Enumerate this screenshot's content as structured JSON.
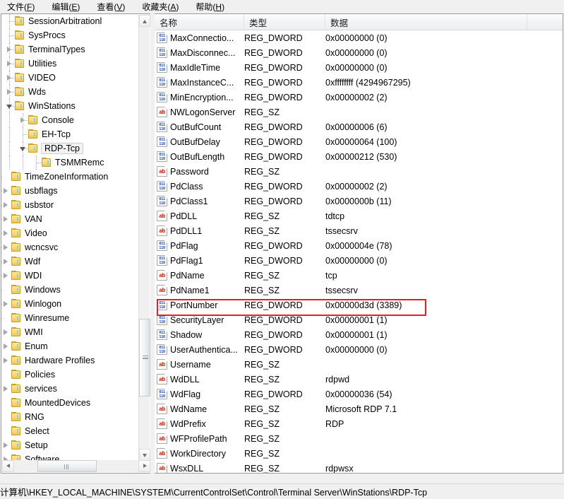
{
  "menu": {
    "items": [
      {
        "label": "文件(F)",
        "mnemonic": "F",
        "base": "文件("
      },
      {
        "label": "编辑(E)",
        "mnemonic": "E",
        "base": "编辑("
      },
      {
        "label": "查看(V)",
        "mnemonic": "V",
        "base": "查看("
      },
      {
        "label": "收藏夹(A)",
        "mnemonic": "A",
        "base": "收藏夹("
      },
      {
        "label": "帮助(H)",
        "mnemonic": "H",
        "base": "帮助("
      }
    ]
  },
  "tree": {
    "nodes": [
      {
        "label": "SessionArbitrationl",
        "indent": 3,
        "arrow": "none",
        "selected": false
      },
      {
        "label": "SysProcs",
        "indent": 3,
        "arrow": "none",
        "selected": false
      },
      {
        "label": "TerminalTypes",
        "indent": 3,
        "arrow": "collapsed",
        "selected": false
      },
      {
        "label": "Utilities",
        "indent": 3,
        "arrow": "collapsed",
        "selected": false
      },
      {
        "label": "VIDEO",
        "indent": 3,
        "arrow": "collapsed",
        "selected": false
      },
      {
        "label": "Wds",
        "indent": 3,
        "arrow": "collapsed",
        "selected": false
      },
      {
        "label": "WinStations",
        "indent": 3,
        "arrow": "expanded",
        "selected": false
      },
      {
        "label": "Console",
        "indent": 4,
        "arrow": "collapsed",
        "selected": false
      },
      {
        "label": "EH-Tcp",
        "indent": 4,
        "arrow": "none",
        "selected": false
      },
      {
        "label": "RDP-Tcp",
        "indent": 4,
        "arrow": "expanded",
        "selected": true
      },
      {
        "label": "TSMMRemc",
        "indent": 5,
        "arrow": "none",
        "selected": false
      },
      {
        "label": "TimeZoneInformation",
        "indent": 2,
        "arrow": "none",
        "selected": false
      },
      {
        "label": "usbflags",
        "indent": 2,
        "arrow": "collapsed",
        "selected": false
      },
      {
        "label": "usbstor",
        "indent": 2,
        "arrow": "collapsed",
        "selected": false
      },
      {
        "label": "VAN",
        "indent": 2,
        "arrow": "collapsed",
        "selected": false
      },
      {
        "label": "Video",
        "indent": 2,
        "arrow": "collapsed",
        "selected": false
      },
      {
        "label": "wcncsvc",
        "indent": 2,
        "arrow": "collapsed",
        "selected": false
      },
      {
        "label": "Wdf",
        "indent": 2,
        "arrow": "collapsed",
        "selected": false
      },
      {
        "label": "WDI",
        "indent": 2,
        "arrow": "collapsed",
        "selected": false
      },
      {
        "label": "Windows",
        "indent": 2,
        "arrow": "none",
        "selected": false
      },
      {
        "label": "Winlogon",
        "indent": 2,
        "arrow": "collapsed",
        "selected": false
      },
      {
        "label": "Winresume",
        "indent": 2,
        "arrow": "none",
        "selected": false
      },
      {
        "label": "WMI",
        "indent": 2,
        "arrow": "collapsed",
        "selected": false
      },
      {
        "label": "Enum",
        "indent": 1,
        "arrow": "collapsed",
        "selected": false
      },
      {
        "label": "Hardware Profiles",
        "indent": 1,
        "arrow": "collapsed",
        "selected": false
      },
      {
        "label": "Policies",
        "indent": 1,
        "arrow": "none",
        "selected": false
      },
      {
        "label": "services",
        "indent": 1,
        "arrow": "collapsed",
        "selected": false
      },
      {
        "label": "MountedDevices",
        "indent": 0,
        "arrow": "none",
        "selected": false
      },
      {
        "label": "RNG",
        "indent": 0,
        "arrow": "none",
        "selected": false
      },
      {
        "label": "Select",
        "indent": 0,
        "arrow": "none",
        "selected": false
      },
      {
        "label": "Setup",
        "indent": 0,
        "arrow": "collapsed",
        "selected": false
      },
      {
        "label": "Software",
        "indent": 0,
        "arrow": "collapsed",
        "selected": false
      }
    ]
  },
  "list": {
    "columns": [
      "名称",
      "类型",
      "数据"
    ],
    "rows": [
      {
        "name": "MaxConnectio...",
        "type": "REG_DWORD",
        "data": "0x00000000 (0)",
        "icon": "dword-icon",
        "highlight": false
      },
      {
        "name": "MaxDisconnec...",
        "type": "REG_DWORD",
        "data": "0x00000000 (0)",
        "icon": "dword-icon",
        "highlight": false
      },
      {
        "name": "MaxIdleTime",
        "type": "REG_DWORD",
        "data": "0x00000000 (0)",
        "icon": "dword-icon",
        "highlight": false
      },
      {
        "name": "MaxInstanceC...",
        "type": "REG_DWORD",
        "data": "0xffffffff (4294967295)",
        "icon": "dword-icon",
        "highlight": false
      },
      {
        "name": "MinEncryption...",
        "type": "REG_DWORD",
        "data": "0x00000002 (2)",
        "icon": "dword-icon",
        "highlight": false
      },
      {
        "name": "NWLogonServer",
        "type": "REG_SZ",
        "data": "",
        "icon": "string-icon",
        "highlight": false
      },
      {
        "name": "OutBufCount",
        "type": "REG_DWORD",
        "data": "0x00000006 (6)",
        "icon": "dword-icon",
        "highlight": false
      },
      {
        "name": "OutBufDelay",
        "type": "REG_DWORD",
        "data": "0x00000064 (100)",
        "icon": "dword-icon",
        "highlight": false
      },
      {
        "name": "OutBufLength",
        "type": "REG_DWORD",
        "data": "0x00000212 (530)",
        "icon": "dword-icon",
        "highlight": false
      },
      {
        "name": "Password",
        "type": "REG_SZ",
        "data": "",
        "icon": "string-icon",
        "highlight": false
      },
      {
        "name": "PdClass",
        "type": "REG_DWORD",
        "data": "0x00000002 (2)",
        "icon": "dword-icon",
        "highlight": false
      },
      {
        "name": "PdClass1",
        "type": "REG_DWORD",
        "data": "0x0000000b (11)",
        "icon": "dword-icon",
        "highlight": false
      },
      {
        "name": "PdDLL",
        "type": "REG_SZ",
        "data": "tdtcp",
        "icon": "string-icon",
        "highlight": false
      },
      {
        "name": "PdDLL1",
        "type": "REG_SZ",
        "data": "tssecsrv",
        "icon": "string-icon",
        "highlight": false
      },
      {
        "name": "PdFlag",
        "type": "REG_DWORD",
        "data": "0x0000004e (78)",
        "icon": "dword-icon",
        "highlight": false
      },
      {
        "name": "PdFlag1",
        "type": "REG_DWORD",
        "data": "0x00000000 (0)",
        "icon": "dword-icon",
        "highlight": false
      },
      {
        "name": "PdName",
        "type": "REG_SZ",
        "data": "tcp",
        "icon": "string-icon",
        "highlight": false
      },
      {
        "name": "PdName1",
        "type": "REG_SZ",
        "data": "tssecsrv",
        "icon": "string-icon",
        "highlight": false
      },
      {
        "name": "PortNumber",
        "type": "REG_DWORD",
        "data": "0x00000d3d (3389)",
        "icon": "dword-icon",
        "highlight": true
      },
      {
        "name": "SecurityLayer",
        "type": "REG_DWORD",
        "data": "0x00000001 (1)",
        "icon": "dword-icon",
        "highlight": false
      },
      {
        "name": "Shadow",
        "type": "REG_DWORD",
        "data": "0x00000001 (1)",
        "icon": "dword-icon",
        "highlight": false
      },
      {
        "name": "UserAuthentica...",
        "type": "REG_DWORD",
        "data": "0x00000000 (0)",
        "icon": "dword-icon",
        "highlight": false
      },
      {
        "name": "Username",
        "type": "REG_SZ",
        "data": "",
        "icon": "string-icon",
        "highlight": false
      },
      {
        "name": "WdDLL",
        "type": "REG_SZ",
        "data": "rdpwd",
        "icon": "string-icon",
        "highlight": false
      },
      {
        "name": "WdFlag",
        "type": "REG_DWORD",
        "data": "0x00000036 (54)",
        "icon": "dword-icon",
        "highlight": false
      },
      {
        "name": "WdName",
        "type": "REG_SZ",
        "data": "Microsoft RDP 7.1",
        "icon": "string-icon",
        "highlight": false
      },
      {
        "name": "WdPrefix",
        "type": "REG_SZ",
        "data": "RDP",
        "icon": "string-icon",
        "highlight": false
      },
      {
        "name": "WFProfilePath",
        "type": "REG_SZ",
        "data": "",
        "icon": "string-icon",
        "highlight": false
      },
      {
        "name": "WorkDirectory",
        "type": "REG_SZ",
        "data": "",
        "icon": "string-icon",
        "highlight": false
      },
      {
        "name": "WsxDLL",
        "type": "REG_SZ",
        "data": "rdpwsx",
        "icon": "string-icon",
        "highlight": false
      }
    ]
  },
  "statusbar": {
    "path": "计算机\\HKEY_LOCAL_MACHINE\\SYSTEM\\CurrentControlSet\\Control\\Terminal Server\\WinStations\\RDP-Tcp"
  },
  "annotations": {
    "highlight_color": "#ee1b24",
    "boxes": [
      "port-number-row",
      "registry-path"
    ]
  }
}
